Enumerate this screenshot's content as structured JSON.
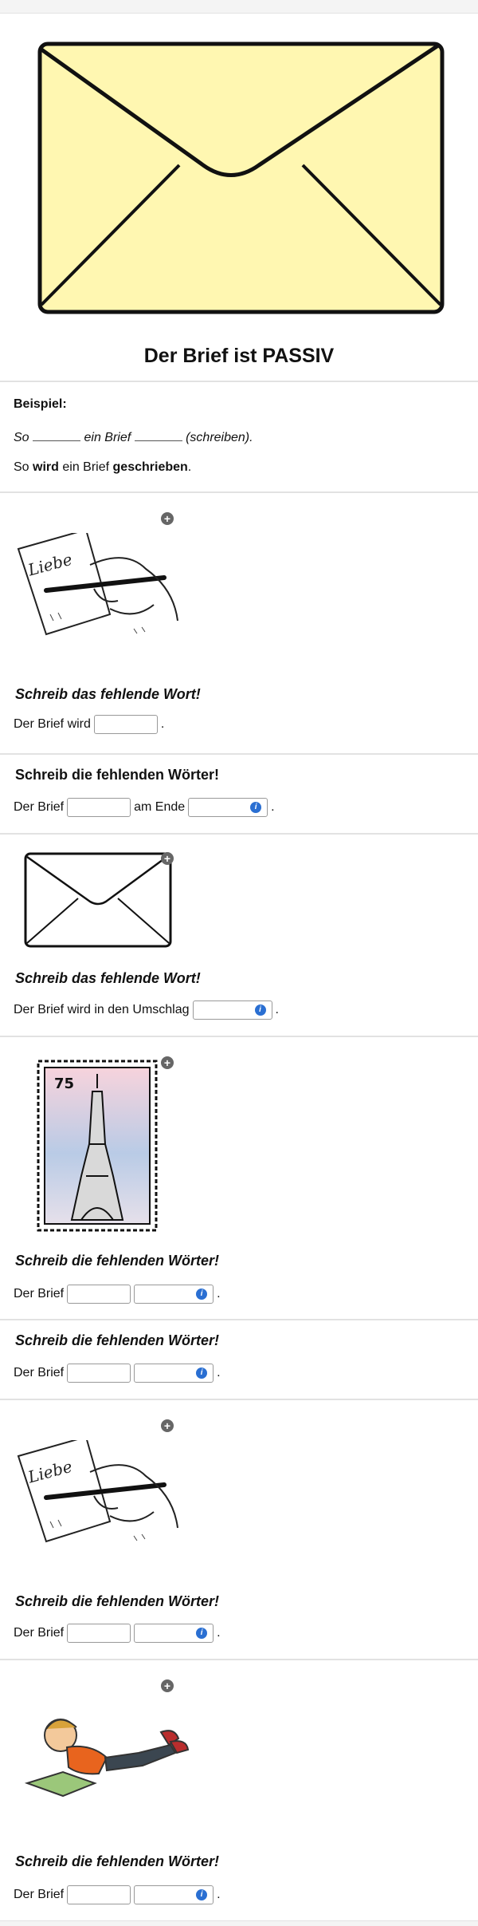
{
  "header": {
    "title": "Der Brief ist PASSIV"
  },
  "example": {
    "label": "Beispiel:",
    "line1_a": "So",
    "line1_b": "ein Brief",
    "line1_c": "(schreiben).",
    "line2_a": "So",
    "line2_bold1": "wird",
    "line2_b": "ein Brief",
    "line2_bold2": "geschrieben",
    "line2_end": "."
  },
  "exercises": [
    {
      "instruction": "Schreib das fehlende Wort!",
      "pre": "Der Brief wird",
      "mid": "",
      "post": "."
    },
    {
      "instruction": "Schreib die fehlenden Wörter!",
      "pre": "Der Brief",
      "mid": "am Ende",
      "post": "."
    },
    {
      "instruction": "Schreib das fehlende Wort!",
      "pre": "Der Brief wird in den Umschlag",
      "mid": "",
      "post": "."
    },
    {
      "instruction": "Schreib die fehlenden Wörter!",
      "pre": "Der Brief",
      "mid": "",
      "post": "."
    },
    {
      "instruction": "Schreib die fehlenden Wörter!",
      "pre": "Der Brief",
      "mid": "",
      "post": "."
    },
    {
      "instruction": "Schreib die fehlenden Wörter!",
      "pre": "Der Brief",
      "mid": "",
      "post": "."
    },
    {
      "instruction": "Schreib die fehlenden Wörter!",
      "pre": "Der Brief",
      "mid": "",
      "post": "."
    }
  ],
  "stamp": {
    "value": "75"
  },
  "handwriting": {
    "text": "Liebe"
  },
  "icons": {
    "add": "plus-circle-icon",
    "info": "info-icon"
  },
  "colors": {
    "envelope_fill": "#fff7b1",
    "info_blue": "#2a6fd2"
  }
}
